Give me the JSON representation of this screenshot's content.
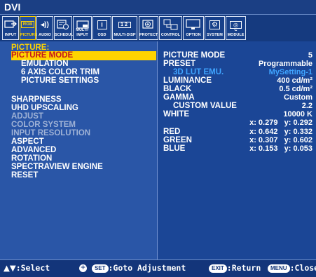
{
  "window": {
    "title": "DVI"
  },
  "tabs": [
    {
      "label": "INPUT",
      "icon": "input-icon"
    },
    {
      "label": "PICTURE",
      "icon": "picture-icon",
      "active": true,
      "glyph": "RGB"
    },
    {
      "label": "AUDIO",
      "icon": "audio-icon",
      "glyph": "◂))"
    },
    {
      "label": "SCHEDULE",
      "icon": "schedule-icon"
    },
    {
      "label": "MULTI-INPUT",
      "icon": "multi-input-icon"
    },
    {
      "label": "OSD",
      "icon": "osd-icon",
      "glyph": "i"
    },
    {
      "label": "MULTI-DISP",
      "icon": "multi-display-icon",
      "glyph": "12"
    },
    {
      "label": "PROTECT",
      "icon": "protect-icon",
      "glyph": "+"
    },
    {
      "label": "CONTROL",
      "icon": "control-icon"
    },
    {
      "label": "OPTION",
      "icon": "option-icon"
    },
    {
      "label": "SYSTEM",
      "icon": "system-icon",
      "glyph": "⚙"
    },
    {
      "label": "C MODULE",
      "icon": "compute-module-icon",
      "glyph": "◎"
    }
  ],
  "left_menu": {
    "heading": "PICTURE:",
    "items": [
      {
        "label": "PICTURE MODE",
        "state": "selected"
      },
      {
        "label": "EMULATION",
        "state": "normal"
      },
      {
        "label": "6 AXIS COLOR TRIM",
        "state": "normal"
      },
      {
        "label": "PICTURE SETTINGS",
        "state": "normal"
      },
      {
        "label": "SHARPNESS",
        "state": "normal"
      },
      {
        "label": "UHD UPSCALING",
        "state": "normal"
      },
      {
        "label": "ADJUST",
        "state": "disabled"
      },
      {
        "label": "COLOR SYSTEM",
        "state": "disabled"
      },
      {
        "label": "INPUT RESOLUTION",
        "state": "disabled"
      },
      {
        "label": "ASPECT",
        "state": "normal"
      },
      {
        "label": "ADVANCED",
        "state": "normal"
      },
      {
        "label": "ROTATION",
        "state": "normal"
      },
      {
        "label": "SPECTRAVIEW ENGINE",
        "state": "normal"
      },
      {
        "label": "RESET",
        "state": "normal"
      }
    ]
  },
  "right_panel": {
    "picture_mode": {
      "label": "PICTURE MODE",
      "value": "5"
    },
    "preset": {
      "label": "PRESET",
      "value": "Programmable"
    },
    "lut_emu": {
      "label": "3D LUT EMU.",
      "value": "MySetting-1"
    },
    "luminance": {
      "label": "LUMINANCE",
      "value": "400 cd/m²"
    },
    "black": {
      "label": "BLACK",
      "value": "0.5 cd/m²"
    },
    "gamma": {
      "label": "GAMMA",
      "value": "Custom"
    },
    "custom_value": {
      "label": "CUSTOM VALUE",
      "value": "2.2"
    },
    "white": {
      "label": "WHITE",
      "value": "10000 K",
      "xy": "x: 0.279   y: 0.292"
    },
    "red": {
      "label": "RED",
      "xy": "x: 0.642   y: 0.332"
    },
    "green": {
      "label": "GREEN",
      "xy": "x: 0.307   y: 0.602"
    },
    "blue": {
      "label": "BLUE",
      "xy": "x: 0.153   y: 0.053"
    }
  },
  "footer": {
    "select": ":Select",
    "set_pill": "SET",
    "goto": ":Goto Adjustment",
    "exit_pill": "EXIT",
    "return": ":Return",
    "menu_pill": "MENU",
    "close": ":Close"
  },
  "colors": {
    "background": "#1a4fa0",
    "highlight": "#ffd400",
    "highlight_text": "#c5161d",
    "sub_value": "#3fa4ff",
    "disabled": "#9fb2d6"
  }
}
